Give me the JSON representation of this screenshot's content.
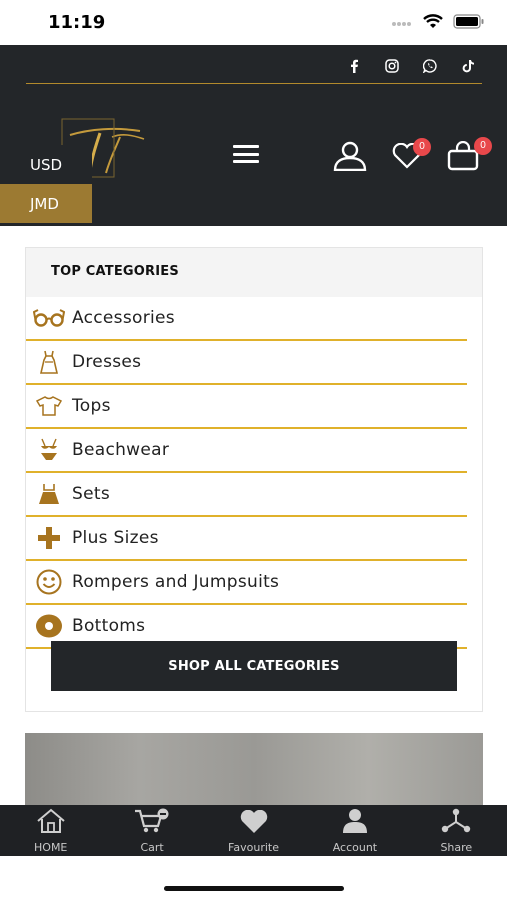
{
  "status": {
    "time": "11:19"
  },
  "header": {
    "currencies": [
      "USD",
      "JMD"
    ],
    "wishlist_count": "0",
    "cart_count": "0"
  },
  "categories": {
    "title": "TOP CATEGORIES",
    "items": [
      {
        "label": "Accessories",
        "icon": "glasses-icon"
      },
      {
        "label": "Dresses",
        "icon": "dress-icon"
      },
      {
        "label": "Tops",
        "icon": "tshirt-icon"
      },
      {
        "label": "Beachwear",
        "icon": "bikini-icon"
      },
      {
        "label": "Sets",
        "icon": "set-icon"
      },
      {
        "label": "Plus Sizes",
        "icon": "plus-icon"
      },
      {
        "label": "Rompers and Jumpsuits",
        "icon": "smiley-icon"
      },
      {
        "label": "Bottoms",
        "icon": "circle-icon"
      }
    ],
    "button": "SHOP ALL CATEGORIES"
  },
  "tabbar": {
    "home": "HOME",
    "cart": "Cart",
    "favourite": "Favourite",
    "account": "Account",
    "share": "Share"
  },
  "colors": {
    "dark": "#232629",
    "gold": "#b28a2c",
    "accent": "#e0b12b",
    "badge": "#e8484b"
  }
}
